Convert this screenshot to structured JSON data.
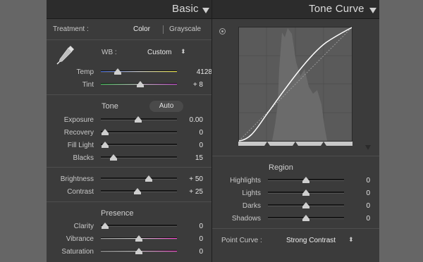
{
  "basic": {
    "title": "Basic",
    "treatment": {
      "label": "Treatment :",
      "options": [
        "Color",
        "Grayscale"
      ],
      "selected": "Color"
    },
    "wb": {
      "label": "WB :",
      "value": "Custom"
    },
    "temp": {
      "label": "Temp",
      "value": "4128",
      "level": 0.22
    },
    "tint": {
      "label": "Tint",
      "value": "+ 8",
      "level": 0.52
    },
    "tone_header": "Tone",
    "auto_label": "Auto",
    "exposure": {
      "label": "Exposure",
      "value": "0.00",
      "level": 0.5
    },
    "recovery": {
      "label": "Recovery",
      "value": "0",
      "level": 0.0
    },
    "fill_light": {
      "label": "Fill Light",
      "value": "0",
      "level": 0.0
    },
    "blacks": {
      "label": "Blacks",
      "value": "15",
      "level": 0.15
    },
    "brightness": {
      "label": "Brightness",
      "value": "+ 50",
      "level": 0.64
    },
    "contrast": {
      "label": "Contrast",
      "value": "+ 25",
      "level": 0.49
    },
    "presence_header": "Presence",
    "clarity": {
      "label": "Clarity",
      "value": "0",
      "level": 0.0
    },
    "vibrance": {
      "label": "Vibrance",
      "value": "0",
      "level": 0.5
    },
    "saturation": {
      "label": "Saturation",
      "value": "0",
      "level": 0.5
    }
  },
  "tone_curve": {
    "title": "Tone Curve",
    "region_header": "Region",
    "highlights": {
      "label": "Highlights",
      "value": "0",
      "level": 0.5
    },
    "lights": {
      "label": "Lights",
      "value": "0",
      "level": 0.5
    },
    "darks": {
      "label": "Darks",
      "value": "0",
      "level": 0.5
    },
    "shadows": {
      "label": "Shadows",
      "value": "0",
      "level": 0.5
    },
    "point_curve": {
      "label": "Point Curve :",
      "value": "Strong Contrast"
    },
    "split_points": [
      0.25,
      0.5,
      0.75
    ]
  },
  "colors": {
    "panel_bg": "#3b3b3b",
    "header_bg": "#2c2c2c",
    "curve_bg": "#5a5a5a",
    "histogram": "#6a6a6a",
    "curve_line": "#ffffff",
    "temp_gradient": [
      "#3a5fd0",
      "#e8e23a"
    ],
    "tint_gradient": [
      "#2fc14a",
      "#c63ad0"
    ],
    "sat_gradient": [
      "#9a9a9a",
      "#ff3ad0"
    ]
  },
  "icons": {
    "panel_toggle": "triangle-down-icon",
    "panel_switch": "panel-switch-icon",
    "eyedropper": "eyedropper-icon",
    "target_adjust": "target-adjust-icon",
    "stepper": "up-down-stepper-icon"
  }
}
